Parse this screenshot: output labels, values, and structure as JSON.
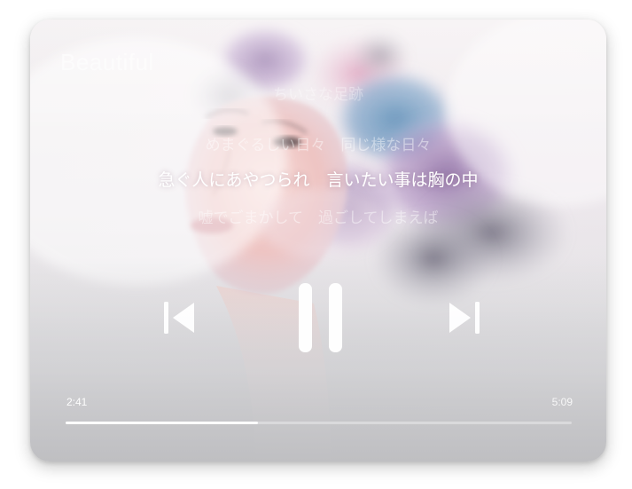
{
  "player": {
    "title": "Beautiful",
    "lyrics": {
      "line1": "ちいさな足跡",
      "line2": "めまぐるしい日々　同じ様な日々",
      "current": "急ぐ人にあやつられ　言いたい事は胸の中",
      "line4": "嘘でごまかして　過ごしてしまえば"
    },
    "time_current": "2:41",
    "time_total": "5:09",
    "progress_fraction": 0.38,
    "state": "playing",
    "icons": {
      "prev": "skip-previous-icon",
      "pause": "pause-icon",
      "next": "skip-next-icon"
    }
  },
  "colors": {
    "control": "#ffffff",
    "progress_track": "rgba(255,255,255,0.35)",
    "progress_fill": "#ffffff"
  }
}
